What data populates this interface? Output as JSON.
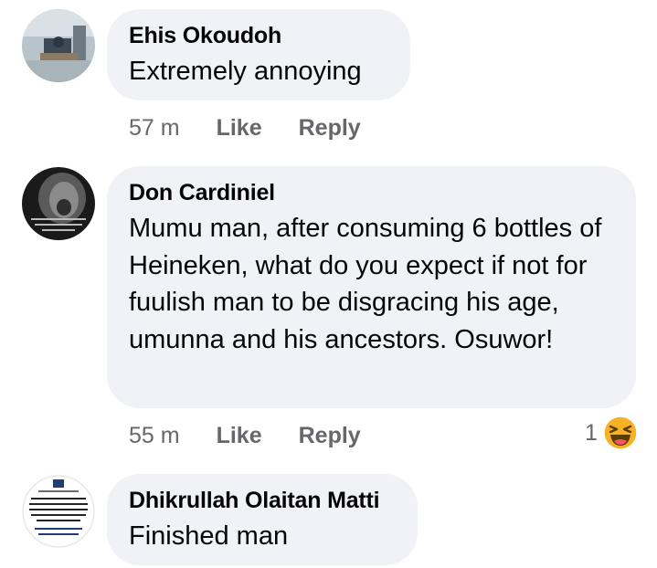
{
  "comments": [
    {
      "author": "Ehis Okoudoh",
      "text": "Extremely annoying",
      "time": "57 m",
      "like_label": "Like",
      "reply_label": "Reply"
    },
    {
      "author": "Don Cardiniel",
      "text": "Mumu man, after consuming 6 bottles of Heineken, what do you expect if not for fuulish man to be disgracing his age, umunna and his ancestors. Osuwor!",
      "time": "55 m",
      "like_label": "Like",
      "reply_label": "Reply",
      "reaction_count": "1",
      "reaction_icon": "haha-emoji-icon"
    },
    {
      "author": "Dhikrullah Olaitan Matti",
      "text": "Finished man"
    }
  ],
  "colors": {
    "bubble": "#f0f2f5",
    "meta_text": "#65676b",
    "emoji_yellow": "#f7b125"
  }
}
